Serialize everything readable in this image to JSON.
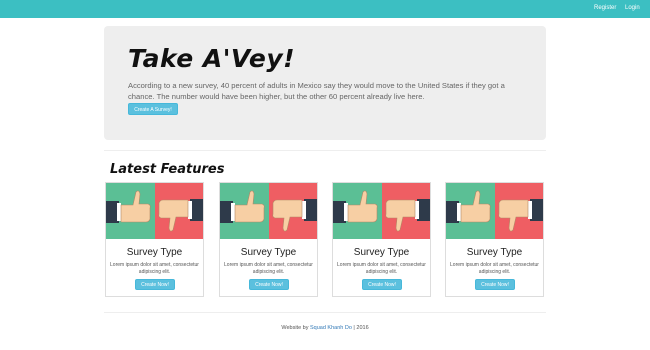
{
  "nav": {
    "register_label": "Register",
    "login_label": "Login",
    "bar_color": "#3cbfc2"
  },
  "hero": {
    "title": "Take A'Vey!",
    "text": "According to a new survey, 40 percent of adults in Mexico say they would move to the United States if they got a chance. The number would have been higher, but the other 60 percent already live here.",
    "button_label": "Create A Survey!"
  },
  "features": {
    "title": "Latest Features",
    "cards": [
      {
        "image_icon": "thumbs-up-down-icon",
        "title": "Survey Type",
        "text": "Lorem ipsum dolor sit amet, consectetur adipiscing elit.",
        "button_label": "Create Now!"
      },
      {
        "image_icon": "thumbs-up-down-icon",
        "title": "Survey Type",
        "text": "Lorem ipsum dolor sit amet, consectetur adipiscing elit.",
        "button_label": "Create Now!"
      },
      {
        "image_icon": "thumbs-up-down-icon",
        "title": "Survey Type",
        "text": "Lorem ipsum dolor sit amet, consectetur adipiscing elit.",
        "button_label": "Create Now!"
      },
      {
        "image_icon": "thumbs-up-down-icon",
        "title": "Survey Type",
        "text": "Lorem ipsum dolor sit amet, consectetur adipiscing elit.",
        "button_label": "Create Now!"
      }
    ]
  },
  "footer": {
    "prefix": "Website by ",
    "author_link": "Squad Khanh Do",
    "suffix": " | 2016"
  },
  "colors": {
    "accent": "#5bc0de",
    "thumb_up_bg": "#5bbf95",
    "thumb_down_bg": "#ef5e63"
  }
}
